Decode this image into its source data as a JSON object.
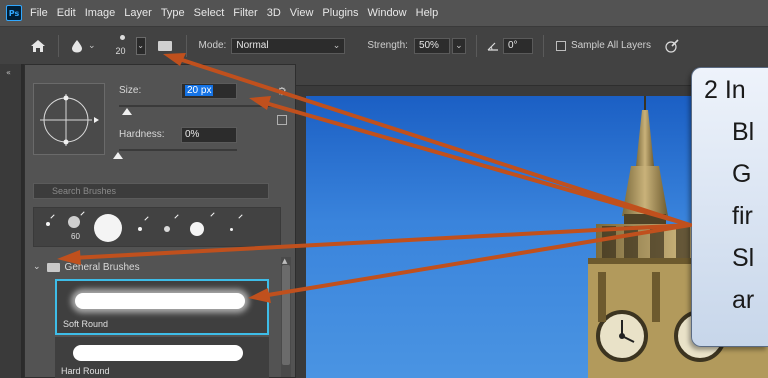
{
  "app": {
    "logo": "Ps"
  },
  "menu": [
    "File",
    "Edit",
    "Image",
    "Layer",
    "Type",
    "Select",
    "Filter",
    "3D",
    "View",
    "Plugins",
    "Window",
    "Help"
  ],
  "options_bar": {
    "brush_size_preview": "20",
    "mode_label": "Mode:",
    "mode_value": "Normal",
    "strength_label": "Strength:",
    "strength_value": "50%",
    "angle_value": "0°",
    "sample_all_layers_label": "Sample All Layers"
  },
  "brush_panel": {
    "size_label": "Size:",
    "size_value": "20 px",
    "hardness_label": "Hardness:",
    "hardness_value": "0%",
    "search_placeholder": "Search Brushes",
    "preset_size_label": "60",
    "folder_label": "General Brushes",
    "brushes": [
      {
        "name": "Soft Round",
        "selected": true
      },
      {
        "name": "Hard Round",
        "selected": false
      }
    ]
  },
  "callout": {
    "lines": [
      "2  In",
      "Bl",
      "G",
      "fir",
      "Sl",
      "ar"
    ]
  },
  "colors": {
    "arrow": "#c0501d",
    "selection": "#3ebde8",
    "sky": "#2f78d6"
  }
}
